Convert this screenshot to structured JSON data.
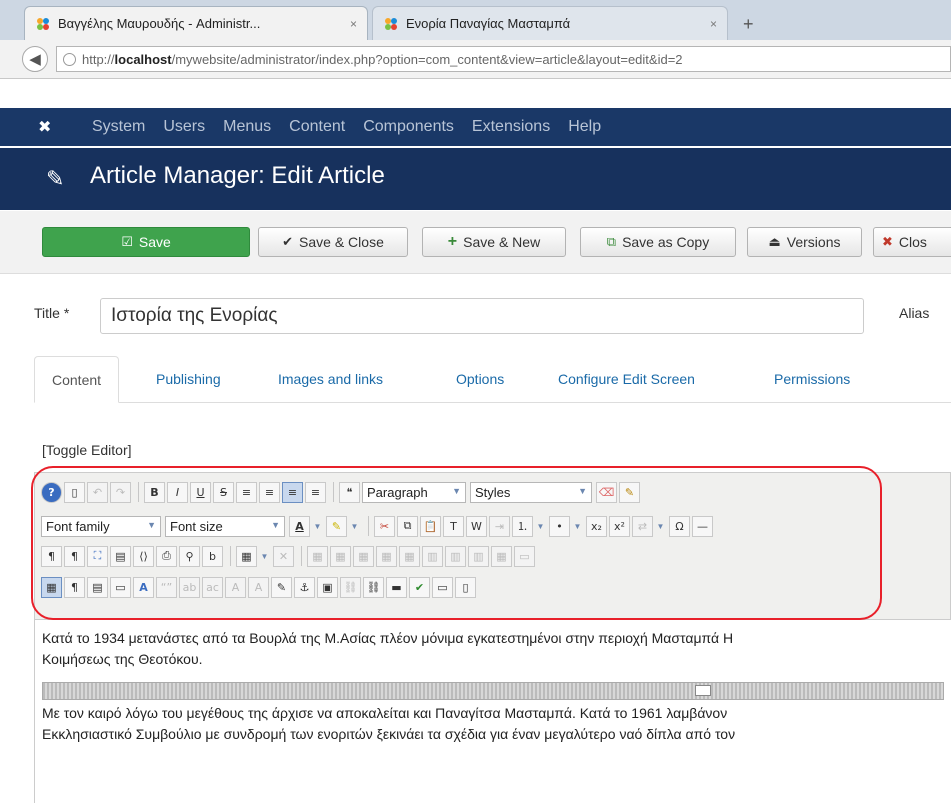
{
  "browser": {
    "tabs": [
      {
        "title": "Βαγγέλης Μαυρουδής - Administr...",
        "close": "×"
      },
      {
        "title": "Ενορία Παναγίας Μασταμπά",
        "close": "×"
      }
    ],
    "new_tab": "+",
    "url_host": "http://",
    "url_bold": "localhost",
    "url_rest": "/mywebsite/administrator/index.php?option=com_content&view=article&layout=edit&id=2"
  },
  "navbar": {
    "items": [
      "System",
      "Users",
      "Menus",
      "Content",
      "Components",
      "Extensions",
      "Help"
    ]
  },
  "header": {
    "title": "Article Manager: Edit Article"
  },
  "toolbar": {
    "save": "Save",
    "save_close": "Save & Close",
    "save_new": "Save & New",
    "save_copy": "Save as Copy",
    "versions": "Versions",
    "close": "Clos"
  },
  "form": {
    "title_label": "Title *",
    "title_value": "Ιστορία της Ενορίας",
    "alias_label": "Alias"
  },
  "tabs": [
    "Content",
    "Publishing",
    "Images and links",
    "Options",
    "Configure Edit Screen",
    "Permissions"
  ],
  "toggle_editor": "[Toggle Editor]",
  "editor": {
    "format_select": "Paragraph",
    "styles_select": "Styles",
    "font_family_select": "Font family",
    "font_size_select": "Font size"
  },
  "content": {
    "p1_line1": "Κατά το 1934 μετανάστες από τα Βουρλά της Μ.Ασίας πλέον μόνιμα εγκατεστημένοι στην περιοχή Μασταμπά Η",
    "p1_line2": "Κοιμήσεως της Θεοτόκου.",
    "p2_line1": "Με τον καιρό λόγω του μεγέθους της άρχισε να αποκαλείται και Παναγίτσα Μασταμπά. Κατά το 1961 λαμβάνον",
    "p2_line2": "Εκκλησιαστικό Συμβούλιο με συνδρομή των ενοριτών ξεκινάει τα σχέδια για έναν μεγαλύτερο ναό δίπλα από τον"
  },
  "colors": {
    "navbar": "#1a3867",
    "header": "#17315d",
    "save": "#3fa34d",
    "highlight": "#e8202a",
    "link": "#1a6aa8"
  }
}
